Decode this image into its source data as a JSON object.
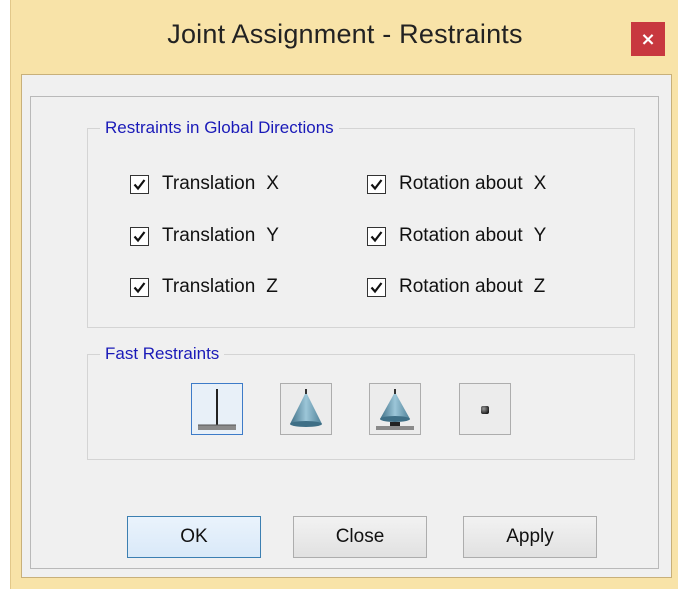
{
  "dialog": {
    "title": "Joint Assignment - Restraints",
    "close_glyph": "×"
  },
  "restraints_group": {
    "legend": "Restraints in Global Directions",
    "items": [
      {
        "label": "Translation",
        "axis": "X",
        "checked": true
      },
      {
        "label": "Translation",
        "axis": "Y",
        "checked": true
      },
      {
        "label": "Translation",
        "axis": "Z",
        "checked": true
      },
      {
        "label": "Rotation about",
        "axis": "X",
        "checked": true
      },
      {
        "label": "Rotation about",
        "axis": "Y",
        "checked": true
      },
      {
        "label": "Rotation about",
        "axis": "Z",
        "checked": true
      }
    ]
  },
  "fast_group": {
    "legend": "Fast Restraints",
    "buttons": [
      {
        "icon": "fixed-support-icon",
        "selected": true
      },
      {
        "icon": "pinned-support-icon",
        "selected": false
      },
      {
        "icon": "roller-support-icon",
        "selected": false
      },
      {
        "icon": "free-joint-icon",
        "selected": false
      }
    ]
  },
  "buttons": {
    "ok": "OK",
    "close": "Close",
    "apply": "Apply"
  },
  "colors": {
    "title_bar": "#f8e3a8",
    "close_button": "#c8383f",
    "legend_text": "#1a1ab8",
    "dialog_bg": "#f0f0f0"
  }
}
